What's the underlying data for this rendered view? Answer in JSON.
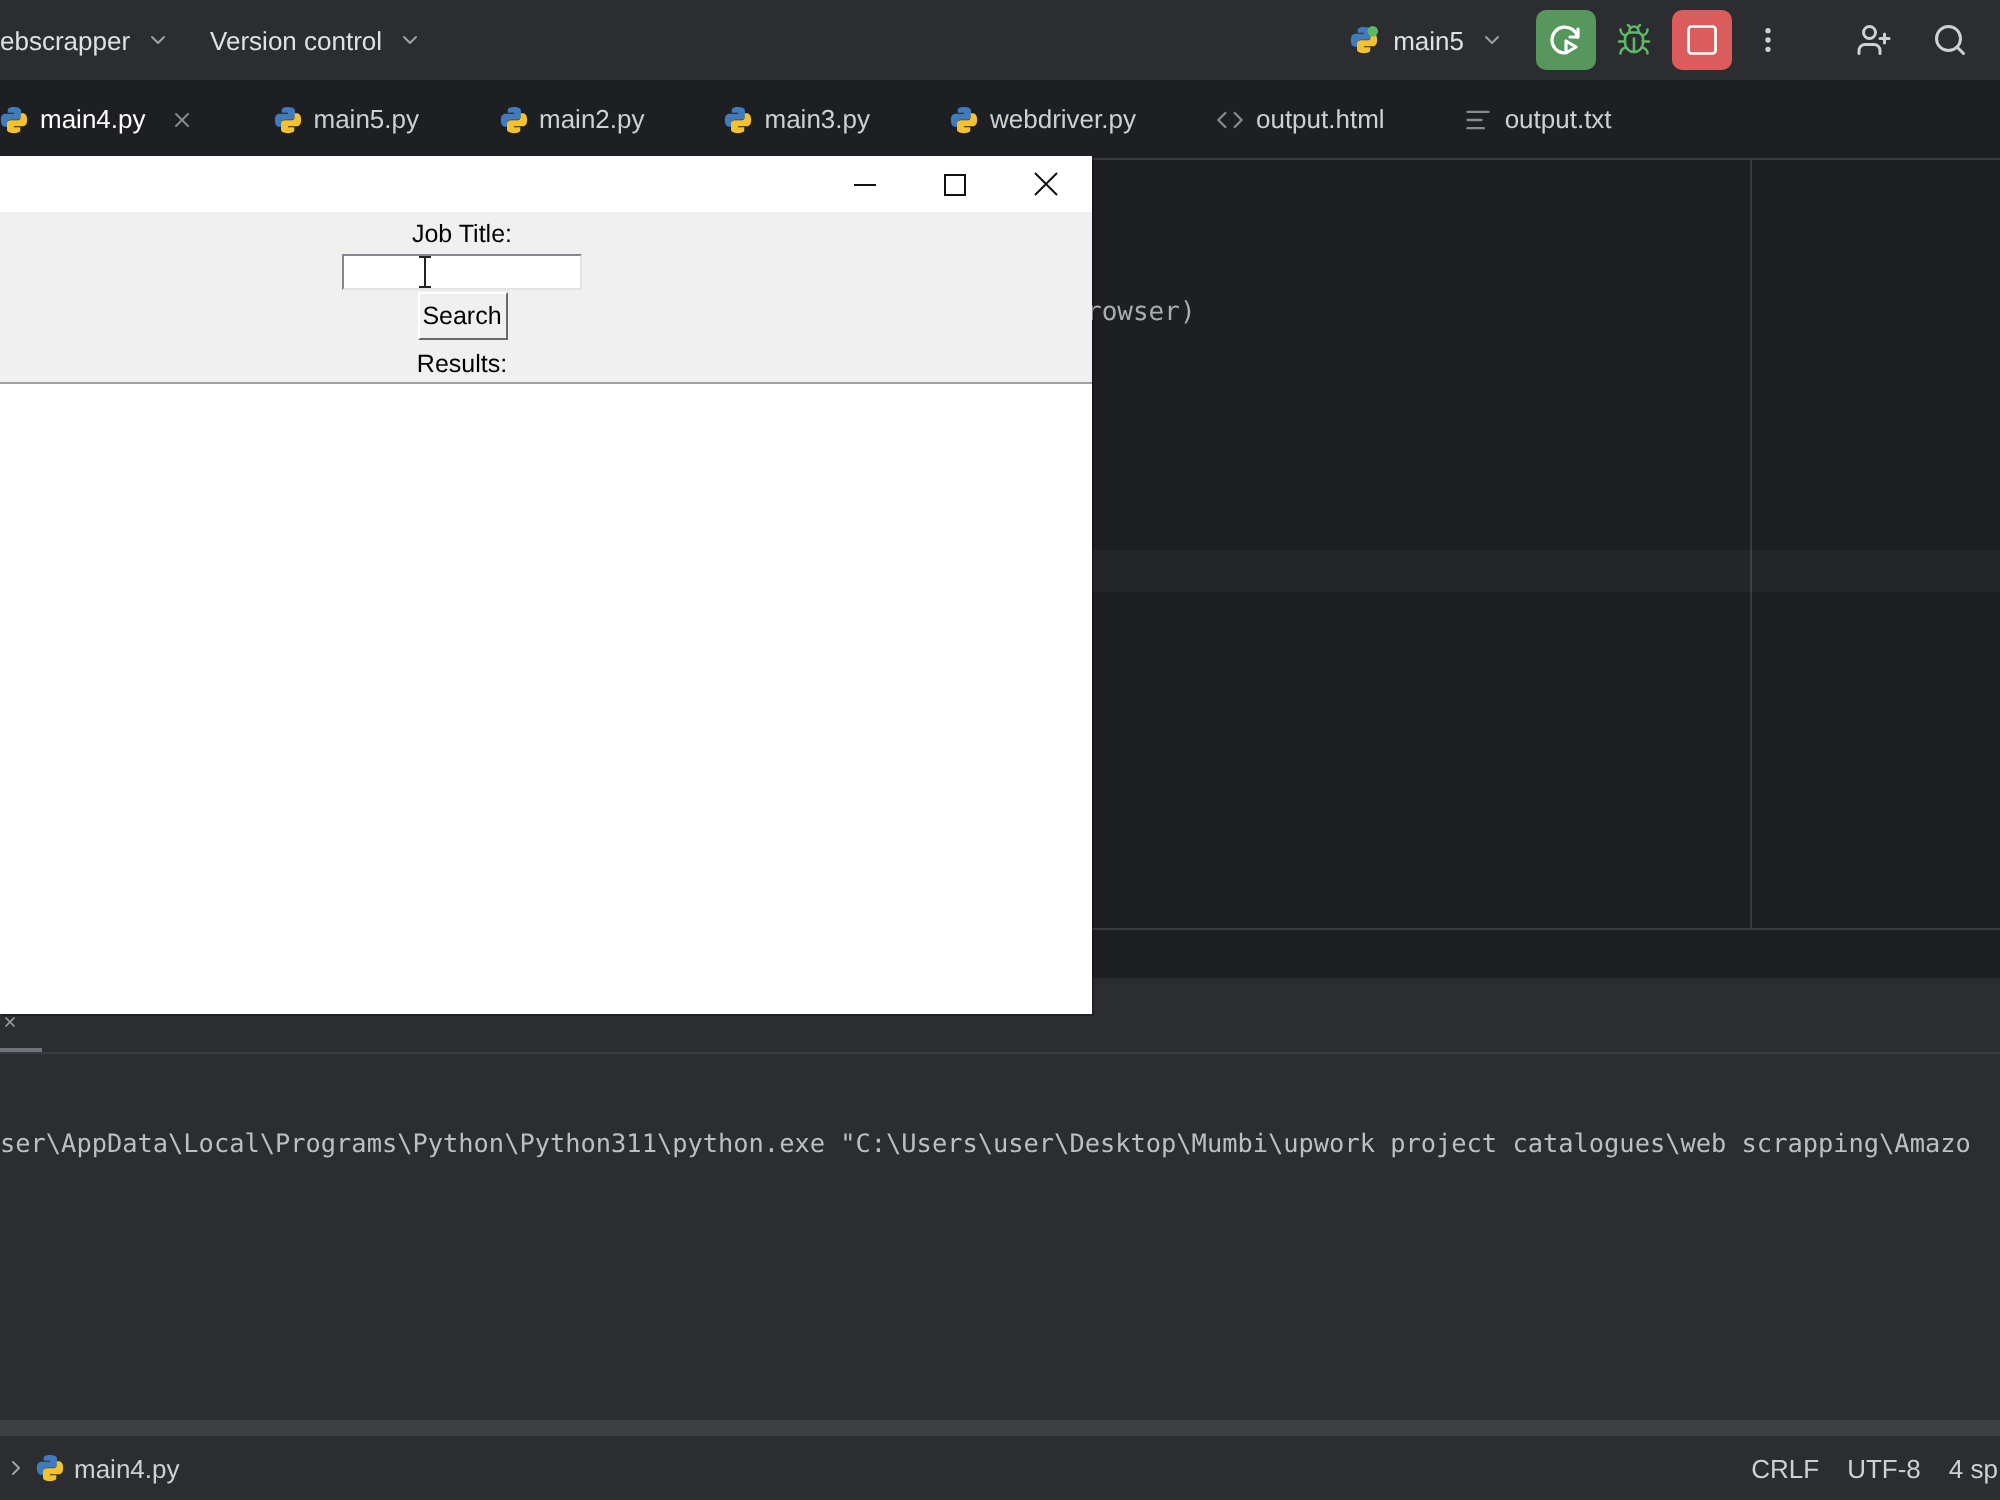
{
  "toolbar": {
    "project": "ebscrapper",
    "vcs": "Version control",
    "run_config": "main5"
  },
  "tabs": [
    {
      "label": "main4.py",
      "kind": "python",
      "selected": true
    },
    {
      "label": "main5.py",
      "kind": "python",
      "selected": false
    },
    {
      "label": "main2.py",
      "kind": "python",
      "selected": false
    },
    {
      "label": "main3.py",
      "kind": "python",
      "selected": false
    },
    {
      "label": "webdriver.py",
      "kind": "python",
      "selected": false
    },
    {
      "label": "output.html",
      "kind": "html",
      "selected": false
    },
    {
      "label": "output.txt",
      "kind": "text",
      "selected": false
    }
  ],
  "editor": {
    "code_line": "rowser)"
  },
  "app_window": {
    "job_title_label": "Job Title:",
    "search_button": "Search",
    "results_label": "Results:"
  },
  "run_panel": {
    "tab": {
      "selected": true
    },
    "console_line": "ser\\AppData\\Local\\Programs\\Python\\Python311\\python.exe \"C:\\Users\\user\\Desktop\\Mumbi\\upwork project catalogues\\web scrapping\\Amazo"
  },
  "status_bar": {
    "file": "main4.py",
    "line_separator": "CRLF",
    "encoding": "UTF-8",
    "indent": "4 sp"
  }
}
